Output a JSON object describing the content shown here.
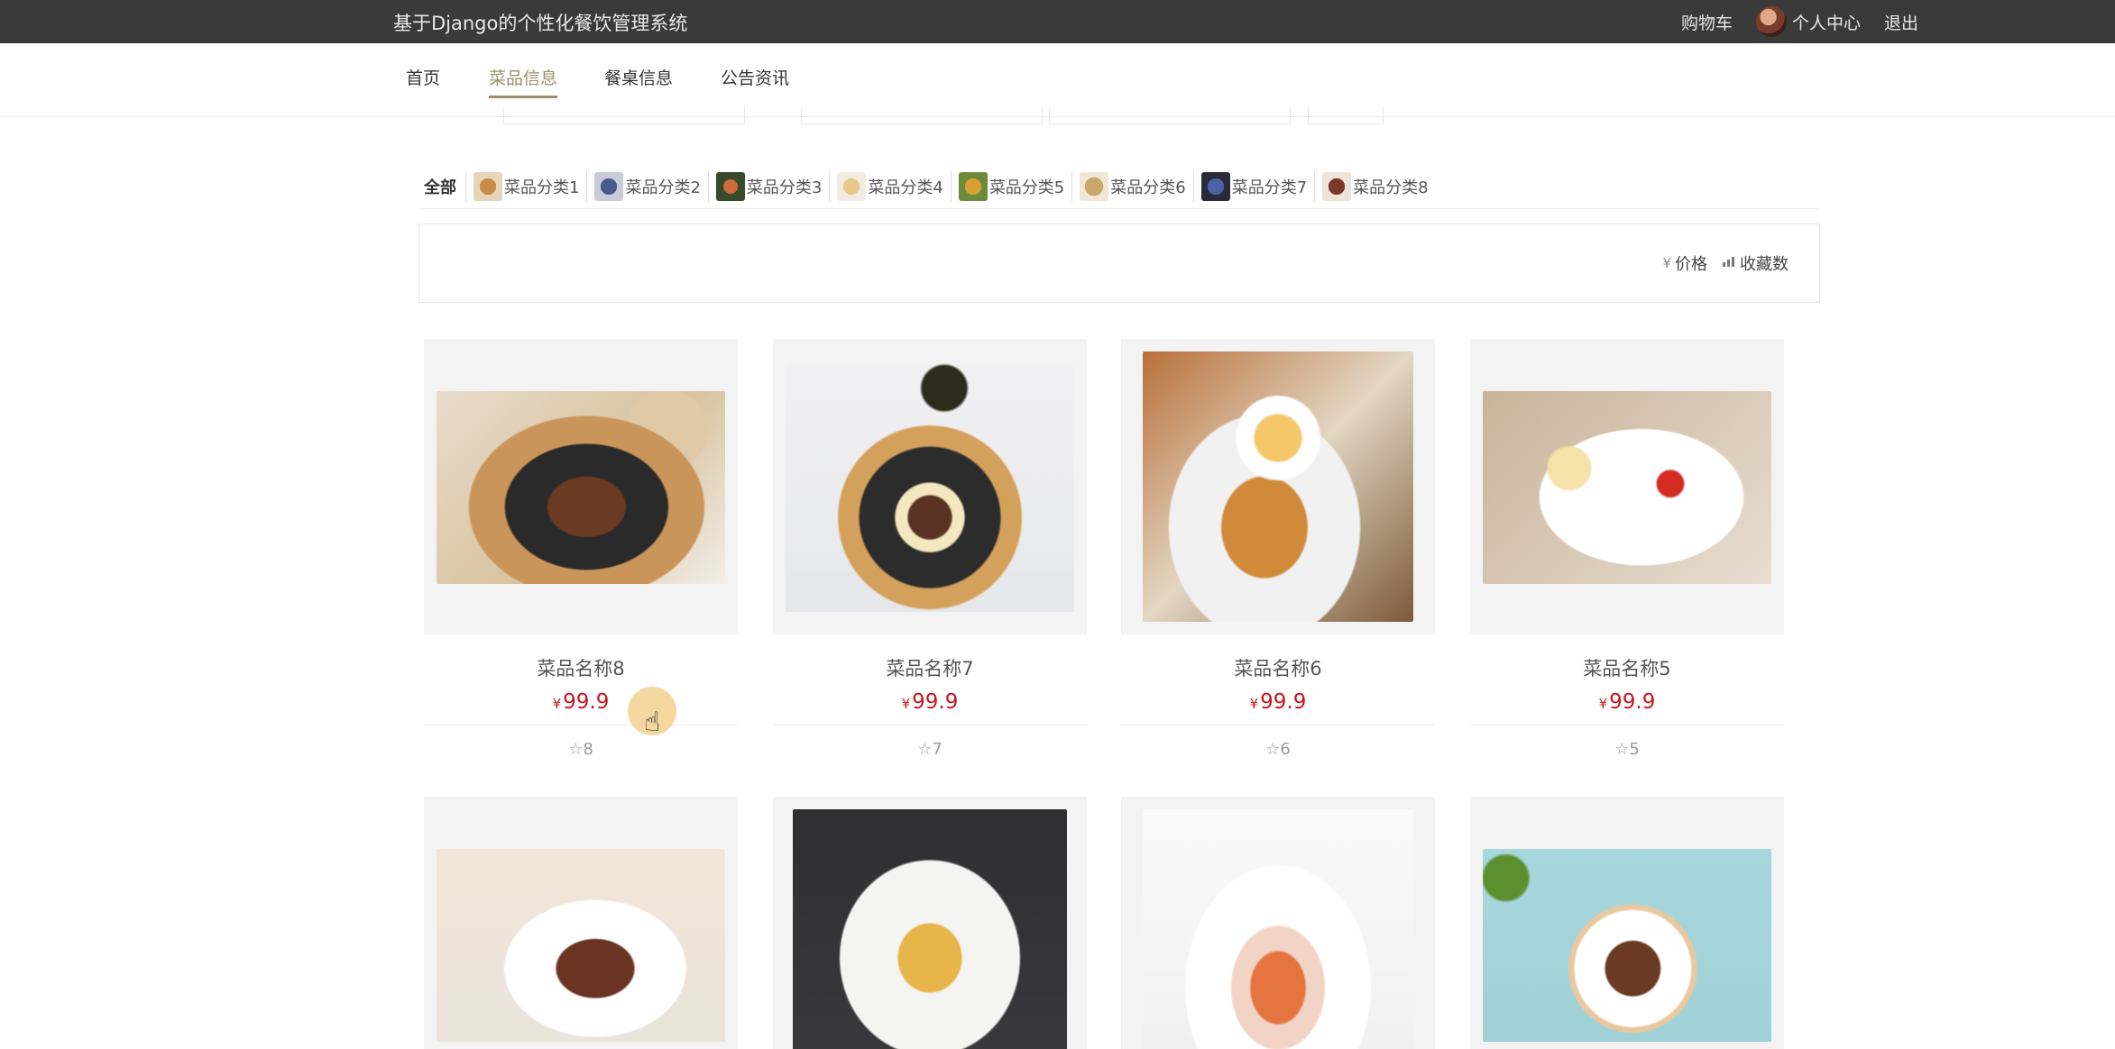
{
  "header": {
    "site_title": "基于Django的个性化餐饮管理系统",
    "cart": "购物车",
    "user_center": "个人中心",
    "logout": "退出"
  },
  "nav": {
    "items": [
      {
        "label": "首页",
        "active": false
      },
      {
        "label": "菜品信息",
        "active": true
      },
      {
        "label": "餐桌信息",
        "active": false
      },
      {
        "label": "公告资讯",
        "active": false
      }
    ]
  },
  "categories": {
    "all": "全部",
    "items": [
      "菜品分类1",
      "菜品分类2",
      "菜品分类3",
      "菜品分类4",
      "菜品分类5",
      "菜品分类6",
      "菜品分类7",
      "菜品分类8"
    ]
  },
  "sort": {
    "price": "价格",
    "price_icon": "¥",
    "favorites": "收藏数",
    "favorites_icon": "bar-chart-icon"
  },
  "currency": "¥",
  "dishes": [
    {
      "name": "菜品名称8",
      "price": "99.9",
      "favorites": "8"
    },
    {
      "name": "菜品名称7",
      "price": "99.9",
      "favorites": "7"
    },
    {
      "name": "菜品名称6",
      "price": "99.9",
      "favorites": "6"
    },
    {
      "name": "菜品名称5",
      "price": "99.9",
      "favorites": "5"
    }
  ],
  "colors": {
    "topbar": "#3a3a3a",
    "nav_active": "#9c8d6c",
    "price": "#c8161d"
  }
}
